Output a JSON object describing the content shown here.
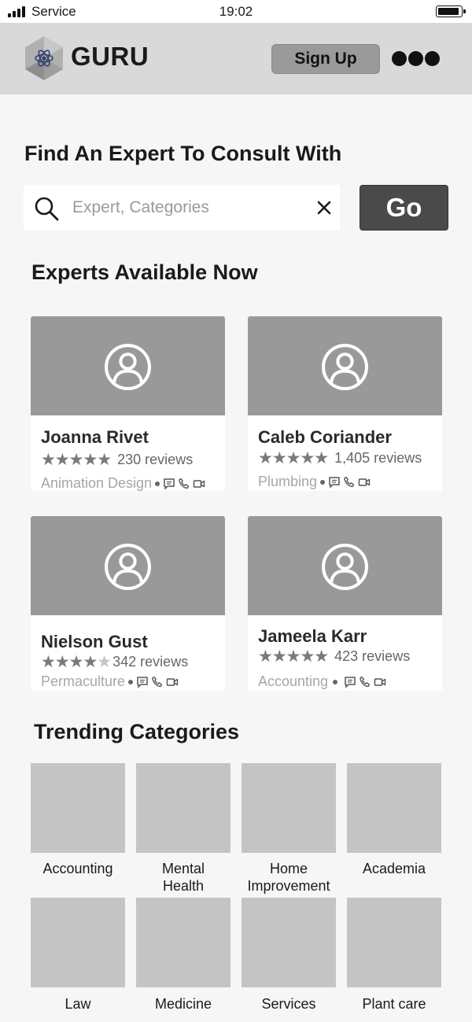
{
  "status_bar": {
    "carrier": "Service",
    "time": "19:02"
  },
  "header": {
    "brand": "GURU",
    "signup_label": "Sign Up",
    "logo_icon": "hexagon-atom-logo",
    "menu_icon": "more-dots-icon"
  },
  "search": {
    "title": "Find An Expert To Consult With",
    "placeholder": "Expert, Categories",
    "value": "",
    "go_label": "Go"
  },
  "experts": {
    "title": "Experts Available Now",
    "items": [
      {
        "name": "Joanna Rivet",
        "rating": 5,
        "reviews": "230 reviews",
        "category": "Animation Design"
      },
      {
        "name": "Caleb Coriander",
        "rating": 5,
        "reviews": "1,405 reviews",
        "category": "Plumbing"
      },
      {
        "name": "Nielson Gust",
        "rating": 4,
        "reviews": "342 reviews",
        "category": "Permaculture"
      },
      {
        "name": "Jameela Karr",
        "rating": 5,
        "reviews": "423 reviews",
        "category": "Accounting"
      }
    ],
    "contact_icons": [
      "chat-icon",
      "phone-icon",
      "video-icon"
    ]
  },
  "categories": {
    "title": "Trending Categories",
    "items": [
      {
        "label": "Accounting"
      },
      {
        "label": "Mental Health"
      },
      {
        "label": "Home Improvement"
      },
      {
        "label": "Academia"
      },
      {
        "label": "Law"
      },
      {
        "label": "Medicine"
      },
      {
        "label": "Services"
      },
      {
        "label": "Plant care"
      }
    ]
  },
  "colors": {
    "header_bg": "#d9d9d9",
    "photo_placeholder": "#999999",
    "go_button": "#4a4a4a",
    "signup_button": "#9a9a9a",
    "tile_placeholder": "#c4c4c4"
  }
}
